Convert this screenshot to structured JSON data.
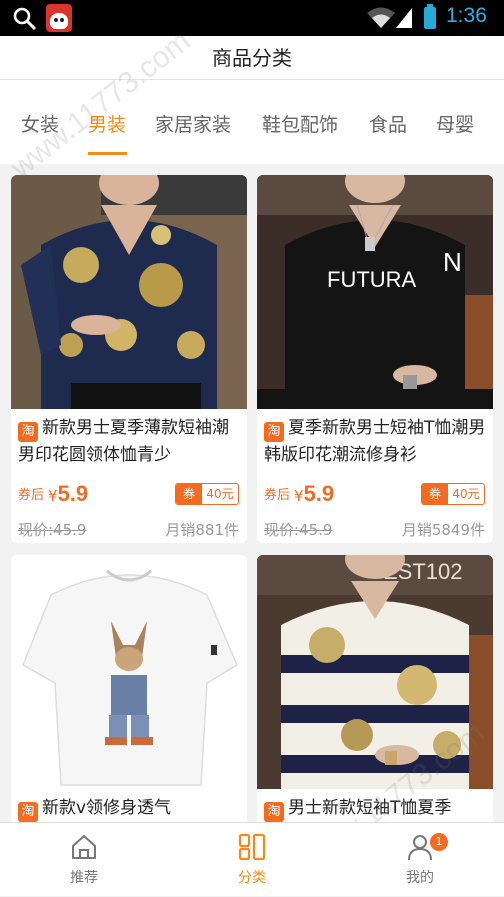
{
  "status_bar": {
    "time": "1:36"
  },
  "header": {
    "title": "商品分类"
  },
  "tabs": [
    {
      "label": "女装",
      "active": false
    },
    {
      "label": "男装",
      "active": true
    },
    {
      "label": "家居家装",
      "active": false
    },
    {
      "label": "鞋包配饰",
      "active": false
    },
    {
      "label": "食品",
      "active": false
    },
    {
      "label": "母婴",
      "active": false
    }
  ],
  "products": [
    {
      "platform_badge": "淘",
      "title": "新款男士夏季薄款短袖潮男印花圆领体恤青少",
      "coupon_price_label": "券后",
      "currency": "¥",
      "coupon_price": "5.9",
      "coupon_tag": "券",
      "coupon_value": "40元",
      "original_price": "现价:45.9",
      "monthly_sales": "月销881件"
    },
    {
      "platform_badge": "淘",
      "title": "夏季新款男士短袖T恤潮男韩版印花潮流修身衫",
      "coupon_price_label": "券后",
      "currency": "¥",
      "coupon_price": "5.9",
      "coupon_tag": "券",
      "coupon_value": "40元",
      "original_price": "现价:45.9",
      "monthly_sales": "月销5849件"
    },
    {
      "platform_badge": "淘",
      "title": "新款v领修身透气"
    },
    {
      "platform_badge": "淘",
      "title": "男士新款短袖T恤夏季"
    }
  ],
  "shirt_prints": {
    "futura_text": "FUTURA",
    "ghost_text": "EST102"
  },
  "bottom_nav": [
    {
      "label": "推荐",
      "icon": "home-icon",
      "active": false
    },
    {
      "label": "分类",
      "icon": "category-icon",
      "active": true
    },
    {
      "label": "我的",
      "icon": "user-icon",
      "active": false,
      "badge": "1"
    }
  ],
  "watermark": "www.11773.com",
  "colors": {
    "accent": "#f38b16",
    "price": "#f26b21"
  }
}
